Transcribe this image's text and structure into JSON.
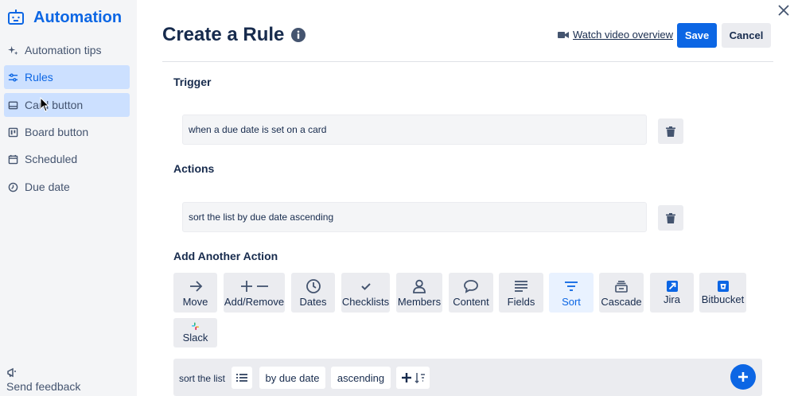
{
  "sidebar": {
    "brand": "Automation",
    "items": [
      {
        "label": "Automation tips",
        "icon": "sparkle-icon"
      },
      {
        "label": "Rules",
        "icon": "sliders-icon"
      },
      {
        "label": "Card button",
        "icon": "card-icon"
      },
      {
        "label": "Board button",
        "icon": "board-icon"
      },
      {
        "label": "Scheduled",
        "icon": "calendar-icon"
      },
      {
        "label": "Due date",
        "icon": "clock-icon"
      }
    ],
    "feedback": "Send feedback"
  },
  "header": {
    "title": "Create a Rule",
    "watch_video": "Watch video overview",
    "save": "Save",
    "cancel": "Cancel"
  },
  "trigger": {
    "title": "Trigger",
    "text": "when a due date is set on a card"
  },
  "actions": {
    "title": "Actions",
    "text": "sort the list by due date ascending"
  },
  "add_action": {
    "title": "Add Another Action",
    "tiles": [
      "Move",
      "Add/Remove",
      "Dates",
      "Checklists",
      "Members",
      "Content",
      "Fields",
      "Sort",
      "Cascade",
      "Jira",
      "Bitbucket",
      "Slack"
    ],
    "selected": "Sort"
  },
  "builder": {
    "prefix": "sort the list",
    "by": "by due date",
    "order": "ascending"
  },
  "colors": {
    "accent": "#0c66e4",
    "sidebar_bg": "#f4f5f7",
    "active_bg": "#cce0ff"
  }
}
